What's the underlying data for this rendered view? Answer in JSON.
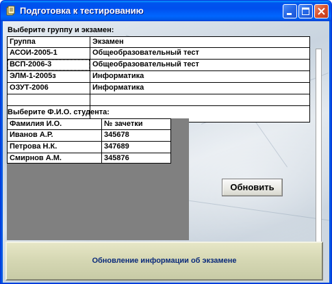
{
  "window": {
    "title": "Подготовка к тестированию"
  },
  "exams_section": {
    "label": "Выберите группу и экзамен:",
    "columns": [
      "Группа",
      "Экзамен"
    ],
    "rows": [
      [
        "АСОИ-2005-1",
        "Общеобразовательный тест"
      ],
      [
        "ВСП-2006-3",
        "Общеобразовательный тест"
      ],
      [
        "ЭЛМ-1-2005з",
        "Информатика"
      ],
      [
        "ОЗУТ-2006",
        "Информатика"
      ]
    ]
  },
  "students_section": {
    "label": "Выберите Ф.И.О. студента:",
    "columns": [
      "Фамилия И.О.",
      "№ зачетки"
    ],
    "rows": [
      [
        "Иванов А.Р.",
        "345678"
      ],
      [
        "Петрова Н.К.",
        "347689"
      ],
      [
        "Смирнов А.М.",
        "345876"
      ]
    ]
  },
  "buttons": {
    "refresh": "Обновить",
    "update_exam_info": "Обновление информации об экзамене"
  },
  "icons": {
    "app": "app-icon",
    "minimize": "minimize-icon",
    "maximize": "maximize-icon",
    "close": "close-icon"
  },
  "colors": {
    "titlebar": "#0054e3",
    "close_button": "#d9502a",
    "update_button_text": "#0a2a7a",
    "gray_panel": "#808080"
  }
}
